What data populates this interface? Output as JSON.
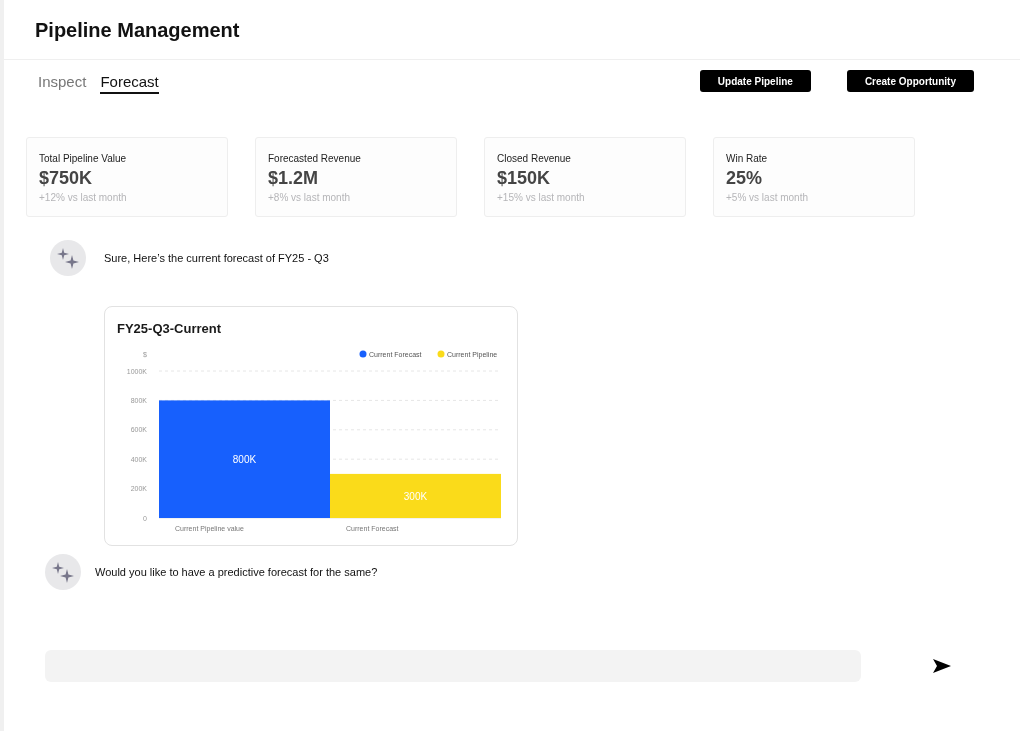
{
  "header": {
    "title": "Pipeline Management"
  },
  "tabs": [
    {
      "label": "Inspect",
      "selected": false
    },
    {
      "label": "Forecast",
      "selected": true
    }
  ],
  "actions": [
    "Update Pipeline",
    "Create Opportunity"
  ],
  "stats": [
    {
      "label": "Total Pipeline Value",
      "value": "$750K",
      "change": "+12% vs last month"
    },
    {
      "label": "Forecasted Revenue",
      "value": "$1.2M",
      "change": "+8% vs last month"
    },
    {
      "label": "Closed Revenue",
      "value": "$150K",
      "change": "+15% vs last month"
    },
    {
      "label": "Win Rate",
      "value": "25%",
      "change": "+5% vs last month"
    }
  ],
  "messages": [
    {
      "text": "Sure, Here’s the current forecast of FY25 - Q3"
    },
    {
      "text": "Would you like to have a predictive forecast for the same?"
    }
  ],
  "chart": {
    "chart_data": {
      "type": "bar",
      "title": "FY25-Q3-Current",
      "ylabel": "$",
      "categories": [
        "Current Pipeline value",
        "Current Forecast"
      ],
      "series": [
        {
          "name": "Current Forecast",
          "color": "#1760fd",
          "values": [
            800,
            null
          ]
        },
        {
          "name": "Current Pipeline",
          "color": "#fadb1a",
          "values": [
            null,
            300
          ]
        }
      ],
      "ylim": [
        0,
        1000
      ],
      "yticks": [
        {
          "value": 0,
          "label": "0"
        },
        {
          "value": 200,
          "label": "200K"
        },
        {
          "value": 400,
          "label": "400K"
        },
        {
          "value": 600,
          "label": "600K"
        },
        {
          "value": 800,
          "label": "800K"
        },
        {
          "value": 1000,
          "label": "1000K"
        }
      ],
      "value_labels": [
        "800K",
        "300K"
      ],
      "grid": true,
      "legend": true
    }
  }
}
